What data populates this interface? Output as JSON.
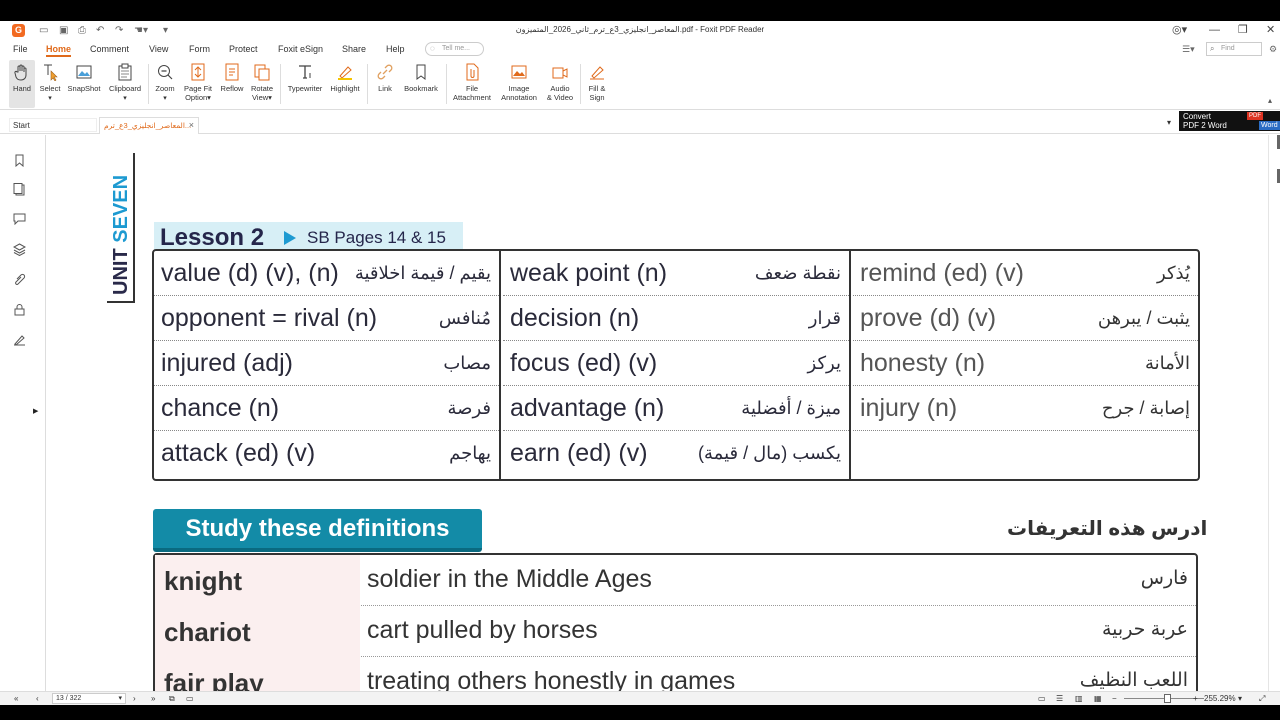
{
  "app": {
    "window_title": "المعاصر_انجليزي_3ع_ترم_ثاني_2026_المتميزون.pdf - Foxit PDF Reader",
    "logo_letter": "G"
  },
  "menu": {
    "file": "File",
    "home": "Home",
    "comment": "Comment",
    "view": "View",
    "form": "Form",
    "protect": "Protect",
    "esign": "Foxit eSign",
    "share": "Share",
    "help": "Help",
    "tell_me": "Tell me...",
    "find_placeholder": "Find"
  },
  "ribbon": {
    "hand": "Hand",
    "select": "Select",
    "snapshot": "SnapShot",
    "clipboard": "Clipboard",
    "zoom": "Zoom",
    "pagefit1": "Page Fit",
    "pagefit2": "Option",
    "reflow": "Reflow",
    "rotate1": "Rotate",
    "rotate2": "View",
    "typewriter": "Typewriter",
    "highlight": "Highlight",
    "link": "Link",
    "bookmark": "Bookmark",
    "fileatt1": "File",
    "fileatt2": "Attachment",
    "imgann1": "Image",
    "imgann2": "Annotation",
    "av1": "Audio",
    "av2": "& Video",
    "fs1": "Fill &",
    "fs2": "Sign"
  },
  "tabs": {
    "start": "Start",
    "doc": "المعاصر_انجليزي_3ع_ترم..."
  },
  "convert": {
    "line1": "Convert",
    "line2": "PDF 2 Word",
    "pdf": "PDF",
    "word": "Word"
  },
  "document": {
    "unit_word1": "UNIT",
    "unit_word2": "SEVEN",
    "lesson": "Lesson 2",
    "pages": "SB Pages 14 & 15",
    "vocab": {
      "col1": [
        {
          "en": "value (d) (v), (n)",
          "ar": "يقيم / قيمة اخلاقية"
        },
        {
          "en": "opponent = rival (n)",
          "ar": "مُنافس"
        },
        {
          "en": "injured (adj)",
          "ar": "مصاب"
        },
        {
          "en": "chance (n)",
          "ar": "فرصة"
        },
        {
          "en": "attack (ed) (v)",
          "ar": "يهاجم"
        }
      ],
      "col2": [
        {
          "en": "weak point (n)",
          "ar": "نقطة ضعف"
        },
        {
          "en": "decision (n)",
          "ar": "قرار"
        },
        {
          "en": "focus (ed) (v)",
          "ar": "يركز"
        },
        {
          "en": "advantage (n)",
          "ar": "ميزة / أفضلية"
        },
        {
          "en": "earn (ed) (v)",
          "ar": "يكسب (مال / قيمة)"
        }
      ],
      "col3": [
        {
          "en": "remind (ed) (v)",
          "ar": "يُذكر"
        },
        {
          "en": "prove (d) (v)",
          "ar": "يثبت / يبرهن"
        },
        {
          "en": "honesty (n)",
          "ar": "الأمانة"
        },
        {
          "en": "injury (n)",
          "ar": "إصابة / جرح"
        }
      ]
    },
    "study_title": "Study these definitions",
    "study_title_ar": "ادرس هذه التعريفات",
    "definitions": [
      {
        "term": "knight",
        "def": "soldier in the Middle Ages",
        "ar": "فارس"
      },
      {
        "term": "chariot",
        "def": "cart pulled by horses",
        "ar": "عربة حربية"
      },
      {
        "term": "fair play",
        "def": "treating others honestly in games",
        "ar": "اللعب النظيف"
      }
    ]
  },
  "status": {
    "page_indicator": "13 / 322",
    "zoom": "255.29%"
  },
  "colors": {
    "accent": "#e06a1b",
    "study_bg": "#138ba7",
    "lesson_bg": "#d7eff6",
    "unit_blue": "#1d9ad1"
  }
}
